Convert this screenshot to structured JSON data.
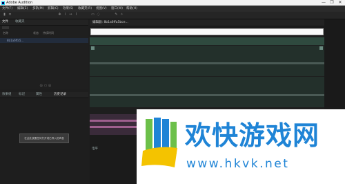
{
  "window": {
    "title": "Adobe Audition",
    "controls": [
      "—",
      "❐",
      "✕"
    ]
  },
  "menubar": {
    "items": [
      "文件(F)",
      "编辑(E)",
      "多轨(M)",
      "剪辑(C)",
      "效果(S)",
      "收藏夹(R)",
      "视图(V)",
      "窗口(W)",
      "帮助(H)"
    ]
  },
  "toolbar": {
    "icons": [
      "waveform-view-icon",
      "multitrack-view-icon",
      "move-tool-icon",
      "razor-tool-icon",
      "slip-tool-icon",
      "time-selection-icon",
      "marquee-icon",
      "lasso-icon",
      "brush-icon",
      "spot-heal-icon"
    ]
  },
  "left_top_panel": {
    "tabs": [
      "文件",
      "收藏夹"
    ],
    "columns": [
      "名称",
      "状态",
      "持续时间"
    ],
    "file_name": "8b1a6ffa5..."
  },
  "editor": {
    "tab_label": "编辑器: 8b1a6ffa5bce..."
  },
  "left_bottom_panel": {
    "tabs": [
      "效果组",
      "标记",
      "属性",
      "历史记录"
    ],
    "dialog_text": "在此处放置任何打开或已导入的声音"
  },
  "bottom_mid": {
    "label": "电平"
  },
  "brand": {
    "chinese": "欢快游戏网",
    "url": "www.hkvk.net",
    "colors": {
      "blue": "#1f84d6",
      "green": "#6cc04a",
      "yellow": "#f4c300"
    }
  }
}
